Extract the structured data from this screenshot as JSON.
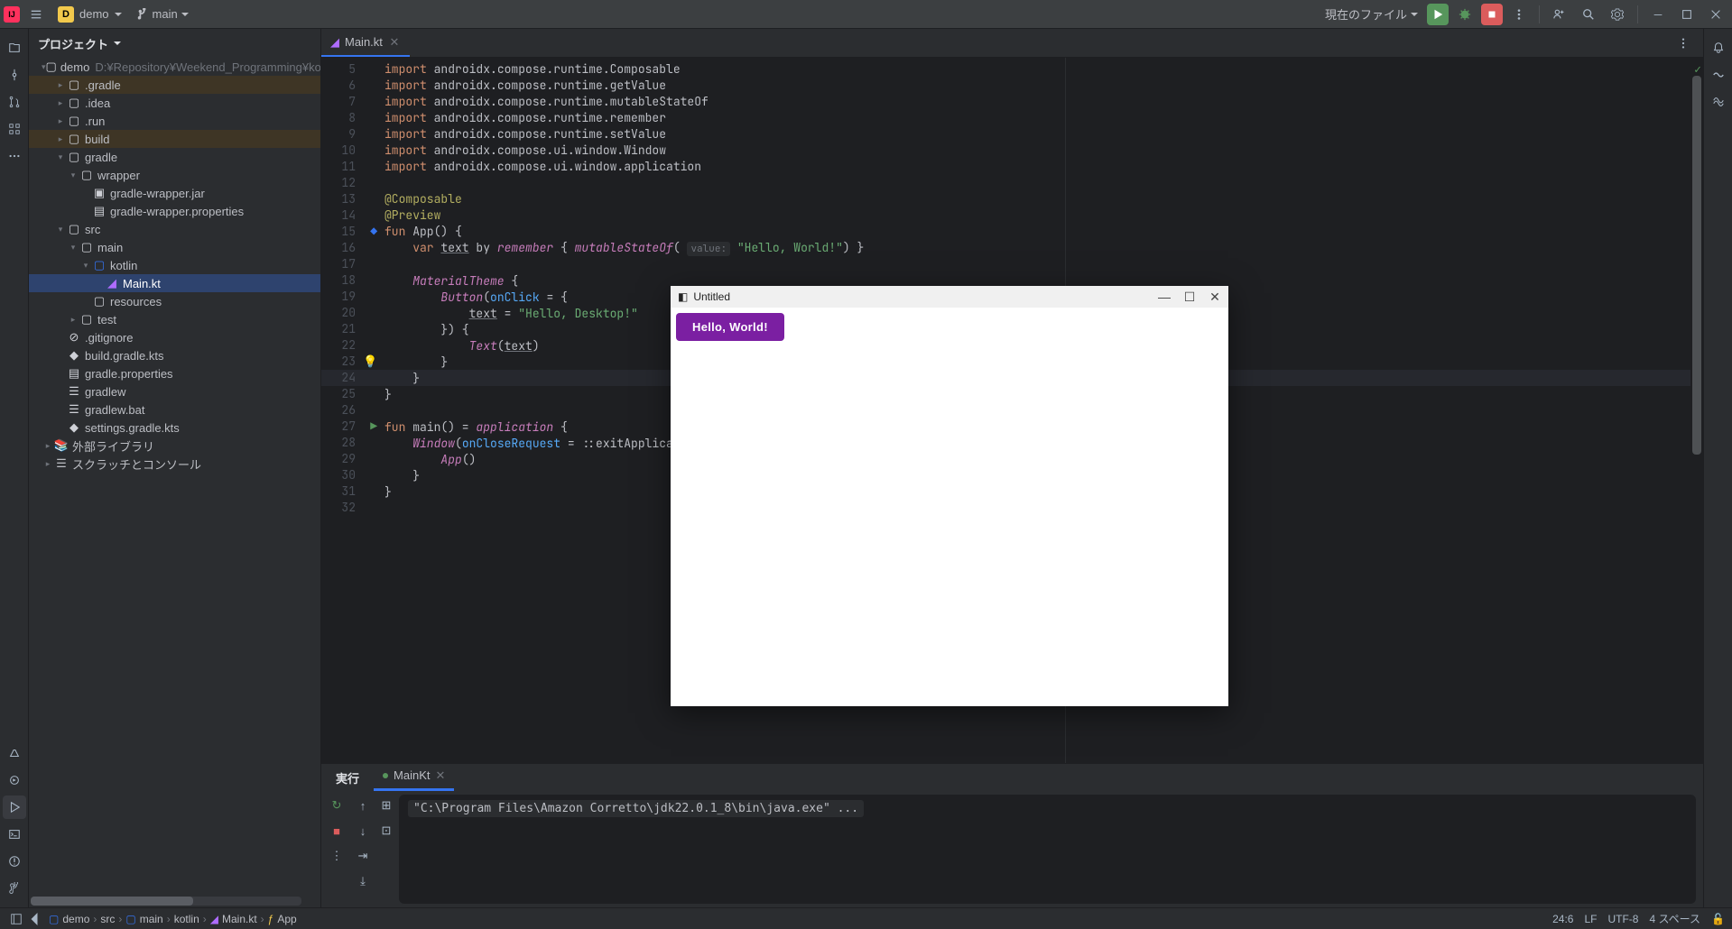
{
  "titlebar": {
    "project": "demo",
    "branch": "main",
    "run_config": "現在のファイル"
  },
  "project_view": {
    "title": "プロジェクト",
    "root_name": "demo",
    "root_path": "D:¥Repository¥Weekend_Programming¥kotlin¥compose¥dem",
    "items": {
      "gradle_dir": ".gradle",
      "idea_dir": ".idea",
      "run_dir": ".run",
      "build_dir": "build",
      "gradle": "gradle",
      "wrapper": "wrapper",
      "wrapper_jar": "gradle-wrapper.jar",
      "wrapper_props": "gradle-wrapper.properties",
      "src": "src",
      "main": "main",
      "kotlin": "kotlin",
      "mainkt": "Main.kt",
      "resources": "resources",
      "test": "test",
      "gitignore": ".gitignore",
      "build_kts": "build.gradle.kts",
      "gradle_props": "gradle.properties",
      "gradlew": "gradlew",
      "gradlew_bat": "gradlew.bat",
      "settings_kts": "settings.gradle.kts",
      "ext_libs": "外部ライブラリ",
      "scratches": "スクラッチとコンソール"
    }
  },
  "editor": {
    "tab_name": "Main.kt",
    "gutter_start": 5,
    "gutter_end": 32,
    "code": {
      "l5": {
        "import": "import",
        "rest": "androidx.compose.runtime.Composable"
      },
      "l6": {
        "import": "import",
        "rest": "androidx.compose.runtime.getValue"
      },
      "l7": {
        "import": "import",
        "rest": "androidx.compose.runtime.mutableStateOf"
      },
      "l8": {
        "import": "import",
        "rest": "androidx.compose.runtime.remember"
      },
      "l9": {
        "import": "import",
        "rest": "androidx.compose.runtime.setValue"
      },
      "l10": {
        "import": "import",
        "rest": "androidx.compose.ui.window.Window"
      },
      "l11": {
        "import": "import",
        "rest": "androidx.compose.ui.window.application"
      },
      "l13": "@Composable",
      "l14": "@Preview",
      "l15": {
        "fun": "fun",
        "name": " App() {"
      },
      "l16": {
        "var": "    var ",
        "text": "text",
        "by": " by ",
        "remember": "remember",
        "open": " { ",
        "ms": "mutableStateOf",
        "paren": "(",
        "hint": "value:",
        "str": " \"Hello, World!\"",
        "close": ") }"
      },
      "l18": {
        "pre": "    ",
        "mt": "MaterialTheme",
        "brace": " {"
      },
      "l19": {
        "pre": "        ",
        "btn": "Button",
        "open": "(",
        "param": "onClick",
        "eq": " = {"
      },
      "l20": {
        "pre": "            ",
        "text": "text",
        "eq": " = ",
        "str": "\"Hello, Desktop!\""
      },
      "l21": "        }) {",
      "l22": {
        "pre": "            ",
        "txt": "Text",
        "open": "(",
        "text": "text",
        "close": ")"
      },
      "l23": "        }",
      "l24": "    }",
      "l25": "}",
      "l27": {
        "fun": "fun",
        "main": " main() = ",
        "app": "application",
        "brace": " {"
      },
      "l28": {
        "pre": "    ",
        "win": "Window",
        "open": "(",
        "param": "onCloseRequest",
        "eq": " = ::exitApplication) {"
      },
      "l29": {
        "pre": "        ",
        "app": "App",
        "close": "()"
      },
      "l30": "    }",
      "l31": "}"
    }
  },
  "run": {
    "title": "実行",
    "tab": "MainKt",
    "output": "\"C:\\Program Files\\Amazon Corretto\\jdk22.0.1_8\\bin\\java.exe\" ..."
  },
  "breadcrumbs": {
    "c1": "demo",
    "c2": "src",
    "c3": "main",
    "c4": "kotlin",
    "c5": "Main.kt",
    "c6": "App"
  },
  "status": {
    "pos": "24:6",
    "le": "LF",
    "enc": "UTF-8",
    "indent": "4 スペース"
  },
  "app_window": {
    "title": "Untitled",
    "button_text": "Hello, World!"
  }
}
